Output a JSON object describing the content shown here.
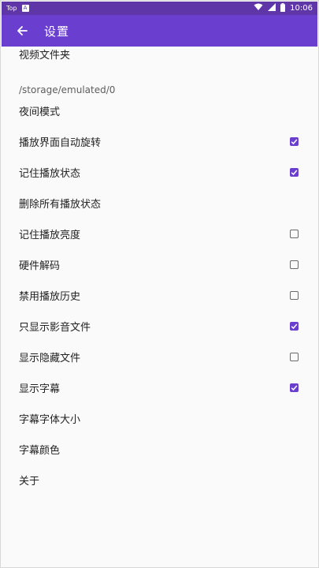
{
  "status_bar": {
    "app_label": "Top",
    "time": "10:06",
    "battery_icon": "battery-icon",
    "wifi_icon": "wifi-icon",
    "signal_icon": "signal-icon"
  },
  "app_bar": {
    "title": "设置",
    "back_icon": "arrow-back-icon",
    "color": "#6a3fd0"
  },
  "settings": [
    {
      "label": "视频文件夹",
      "summary": "/storage/emulated/0"
    },
    {
      "label": "夜间模式"
    },
    {
      "label": "播放界面自动旋转",
      "checked": true
    },
    {
      "label": "记住播放状态",
      "checked": true
    },
    {
      "label": "删除所有播放状态"
    },
    {
      "label": "记住播放亮度",
      "checked": false
    },
    {
      "label": "硬件解码",
      "checked": false
    },
    {
      "label": "禁用播放历史",
      "checked": false
    },
    {
      "label": "只显示影音文件",
      "checked": true
    },
    {
      "label": "显示隐藏文件",
      "checked": false
    },
    {
      "label": "显示字幕",
      "checked": true
    },
    {
      "label": "字幕字体大小"
    },
    {
      "label": "字幕颜色"
    },
    {
      "label": "关于"
    }
  ]
}
